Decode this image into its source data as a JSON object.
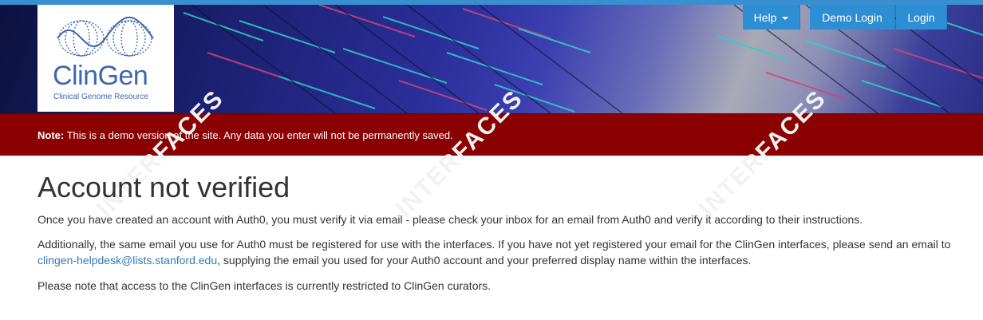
{
  "logo": {
    "name": "ClinGen",
    "subtitle": "Clinical Genome Resource"
  },
  "nav": {
    "help_label": "Help",
    "demo_login_label": "Demo Login",
    "login_label": "Login"
  },
  "notice": {
    "prefix": "Note:",
    "text": " This is a demo version of the site. Any data you enter will not be permanently saved."
  },
  "watermark": "INTERFACES",
  "main": {
    "title": "Account not verified",
    "paragraph1": "Once you have created an account with Auth0, you must verify it via email - please check your inbox for an email from Auth0 and verify it according to their instructions.",
    "paragraph2_before": "Additionally, the same email you use for Auth0 must be registered for use with the interfaces. If you have not yet registered your email for the ClinGen interfaces, please send an email to ",
    "paragraph2_link": "clingen-helpdesk@lists.stanford.edu",
    "paragraph2_after": ", supplying the email you used for your Auth0 account and your preferred display name within the interfaces.",
    "paragraph3": "Please note that access to the ClinGen interfaces is currently restricted to ClinGen curators."
  },
  "colors": {
    "nav_button": "#2e8ed3",
    "notice_bg": "#8b0000",
    "link": "#337ab7",
    "top_line": "#3a8fd1"
  }
}
